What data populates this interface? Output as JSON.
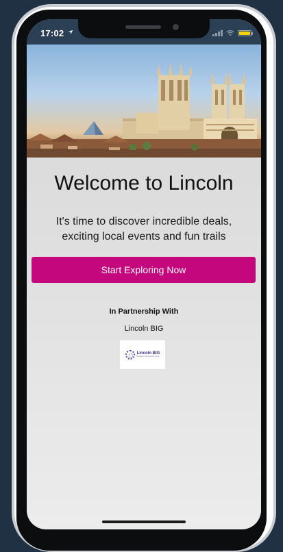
{
  "status_bar": {
    "time": "17:02",
    "location_icon": "location-arrow-icon",
    "signal_icon": "cellular-signal-icon",
    "wifi_icon": "wifi-icon",
    "battery_icon": "battery-icon",
    "battery_color": "#f5d300"
  },
  "hero": {
    "image_description_icon": "cathedral-photo"
  },
  "welcome": {
    "title": "Welcome to Lincoln",
    "subtitle": "It's time to discover incredible deals, exciting local events and fun trails"
  },
  "cta": {
    "label": "Start Exploring Now",
    "color": "#c4077c"
  },
  "partnership": {
    "heading": "In Partnership With",
    "partner_name": "Lincoln BIG",
    "logo_text": "Lincoln BIG",
    "logo_subtext": "Business Improvement Group"
  },
  "colors": {
    "background": "#1f3142",
    "status_bar": "#2b3f55",
    "screen_gradient_top": "#d6d6d6",
    "screen_gradient_bottom": "#ececec"
  }
}
